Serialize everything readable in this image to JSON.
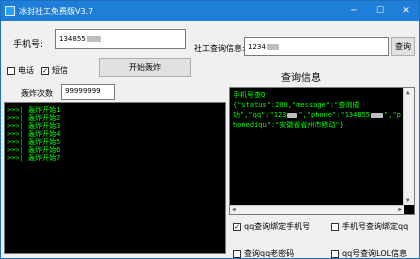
{
  "window": {
    "title": "冰封社工免费版V3.7",
    "minimize": "─",
    "maximize": "☐",
    "close": "✕"
  },
  "phone": {
    "label": "手机号:",
    "value": "134855"
  },
  "social": {
    "label": "社工查询信息:",
    "value": "1234",
    "button": "查询"
  },
  "options": {
    "call": "电话",
    "sms": "短信",
    "sms_checked": true
  },
  "start_button": "开始轰炸",
  "count": {
    "label": "轰炸次数",
    "value": "99999999"
  },
  "log_lines": [
    ">>>|  轰炸开始1",
    ">>>|  轰炸开始2",
    ">>>|  轰炸开始3",
    ">>>|  轰炸开始4",
    ">>>|  轰炸开始5",
    ">>>|  轰炸开始6",
    ">>>|  轰炸开始7"
  ],
  "query_header": "查询信息",
  "result_lines": [
    "手机号查Q",
    "{\"status\":200,\"message\":\"查询成",
    "功\",\"qq\":\"123",
    "\",\"phone\":\"134855",
    "\",\"p",
    "honediqu\":\"安徽省省州市移动\"}"
  ],
  "checkboxes": [
    {
      "label": "qq查询绑定手机号",
      "checked": true
    },
    {
      "label": "手机号查询绑定qq",
      "checked": false
    },
    {
      "label": "查询qq老密码",
      "checked": false
    },
    {
      "label": "qq号查询LOL信息",
      "checked": false
    }
  ]
}
